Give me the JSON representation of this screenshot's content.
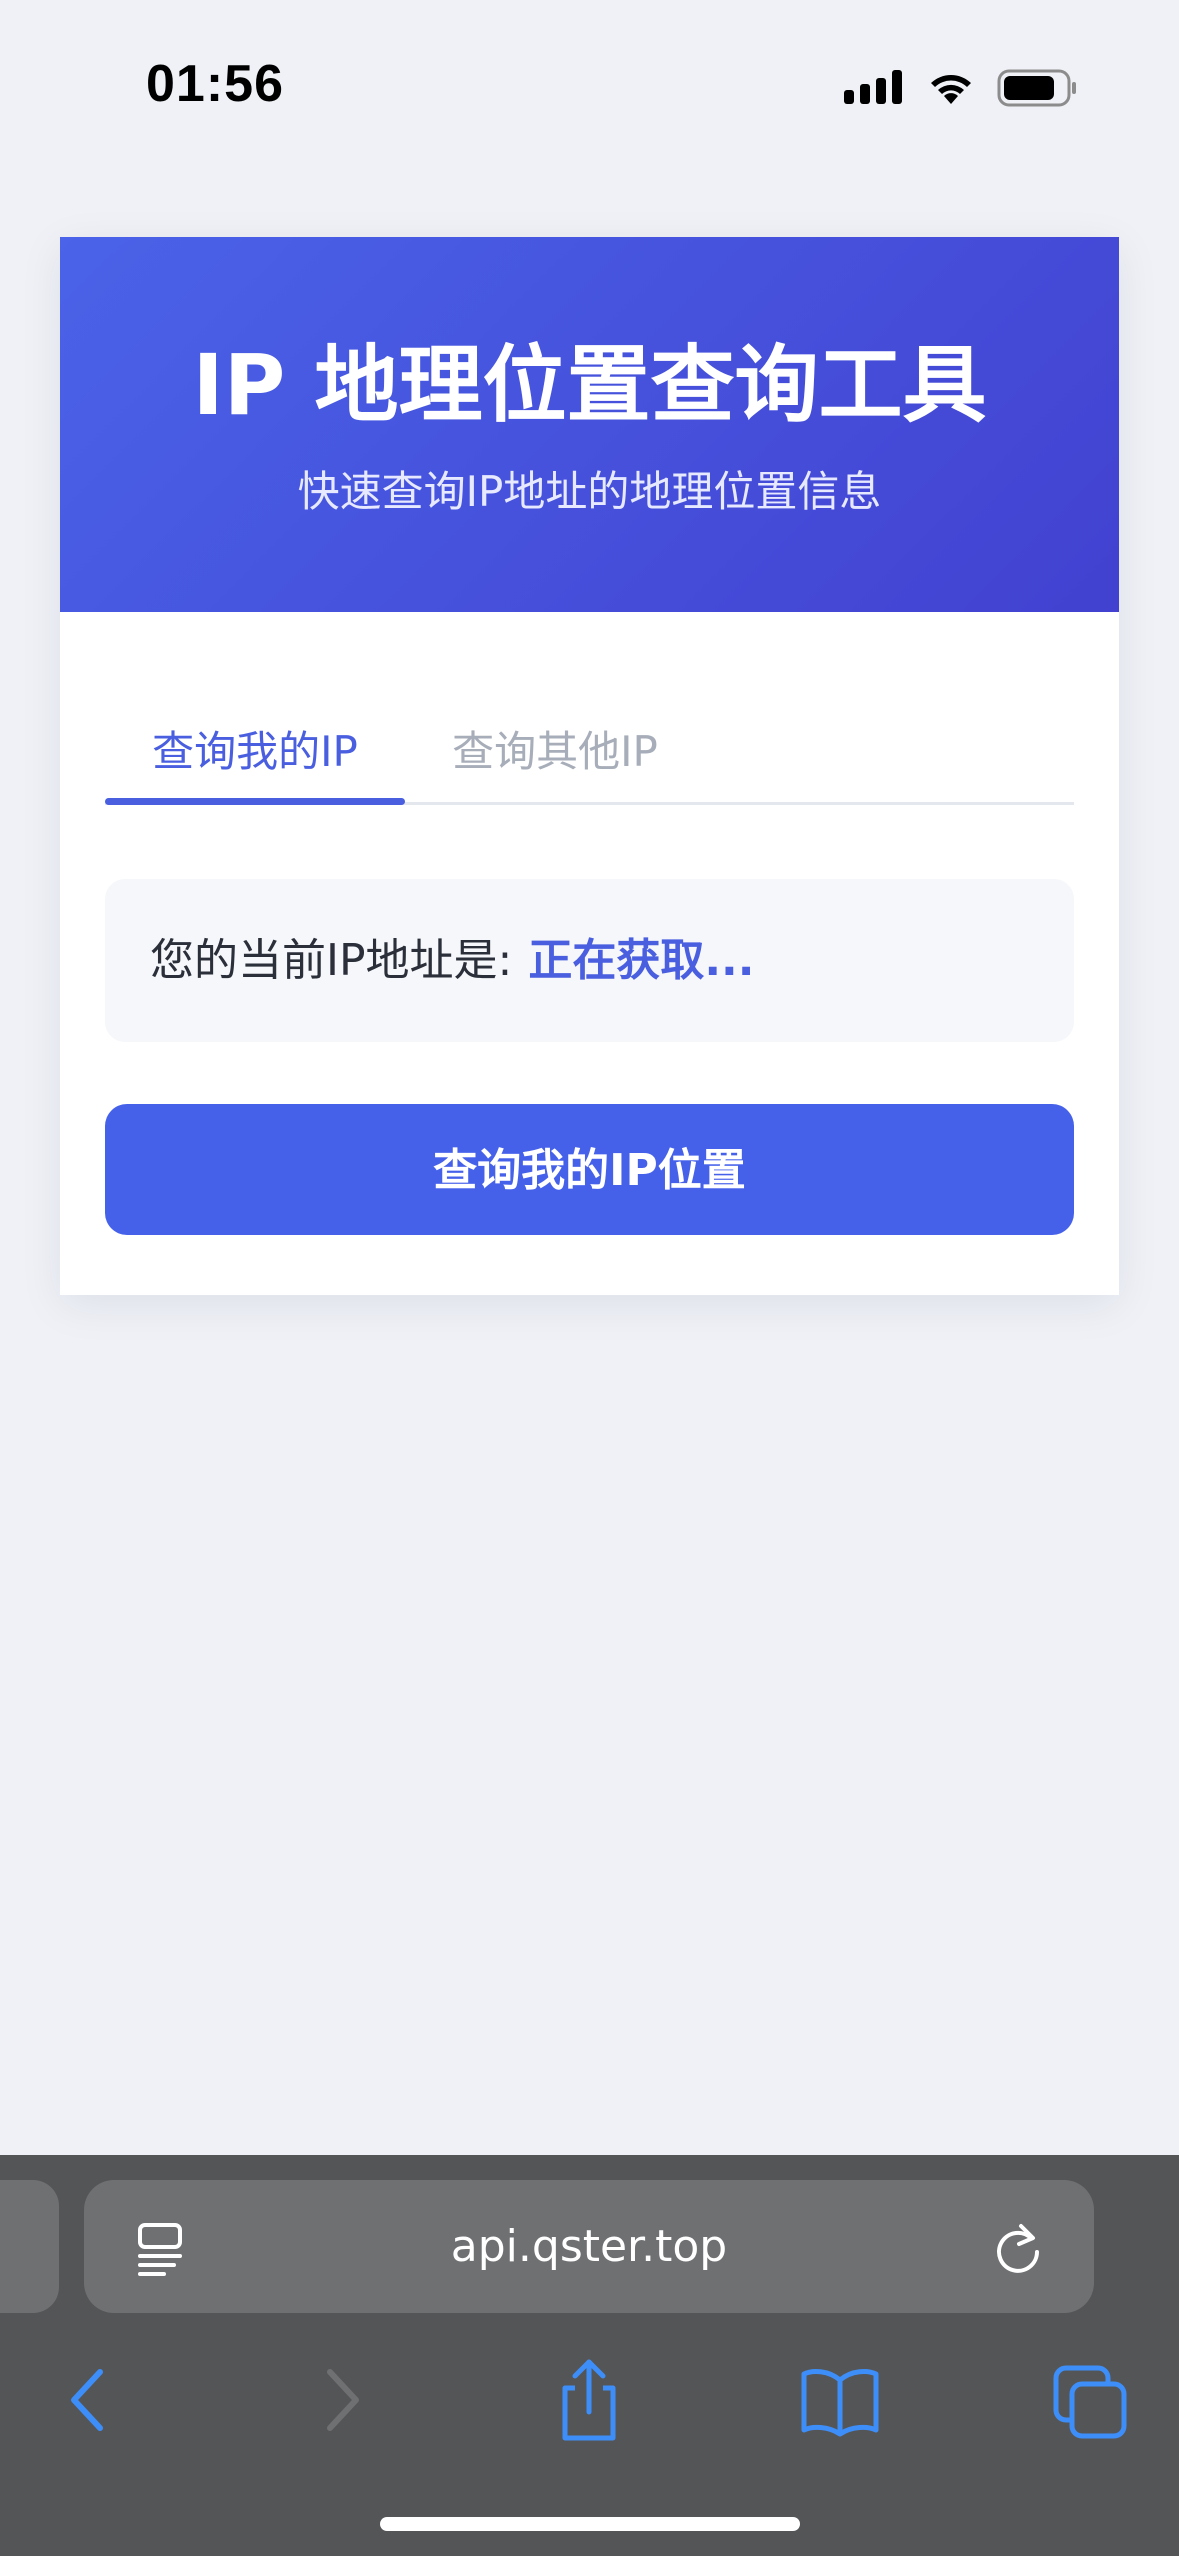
{
  "status_bar": {
    "time": "01:56"
  },
  "card": {
    "title": "IP 地理位置查询工具",
    "subtitle": "快速查询IP地址的地理位置信息",
    "header_gradient": [
      "#4a63e8",
      "#4241d0"
    ],
    "tabs": [
      {
        "label": "查询我的IP",
        "active": true
      },
      {
        "label": "查询其他IP",
        "active": false
      }
    ],
    "ip_label": "您的当前IP地址是:",
    "ip_value": "正在获取...",
    "button_label": "查询我的IP位置",
    "accent_color": "#4561ea"
  },
  "browser": {
    "url": "api.qster.top",
    "icons": {
      "reader": "reader-mode-icon",
      "reload": "reload-icon",
      "back": "back-chevron-icon",
      "forward": "forward-chevron-icon",
      "share": "share-icon",
      "bookmarks": "bookmarks-icon",
      "tabs": "tabs-icon"
    }
  }
}
